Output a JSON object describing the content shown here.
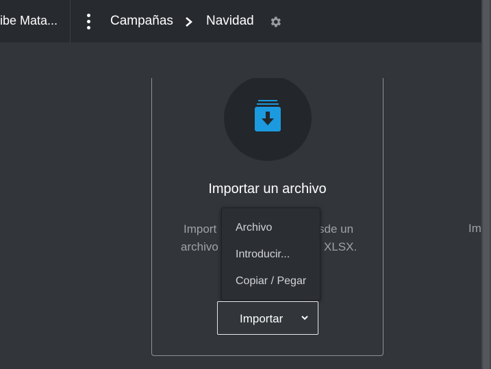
{
  "header": {
    "app_name": "ribe Mata...",
    "breadcrumbs": [
      "Campañas",
      "Navidad"
    ]
  },
  "card": {
    "title": "Importar un archivo",
    "desc_line1_left": "Import",
    "desc_line1_right": "sde un",
    "desc_line2_left": "archivo",
    "desc_line2_right": "XLSX."
  },
  "dropdown": {
    "items": [
      "Archivo",
      "Introducir...",
      "Copiar / Pegar"
    ]
  },
  "import_button": {
    "label": "Importar"
  },
  "side_card": {
    "text": "Im"
  },
  "colors": {
    "accent": "#1b9ae0",
    "topbar": "#272a2e",
    "background": "#32363b"
  }
}
